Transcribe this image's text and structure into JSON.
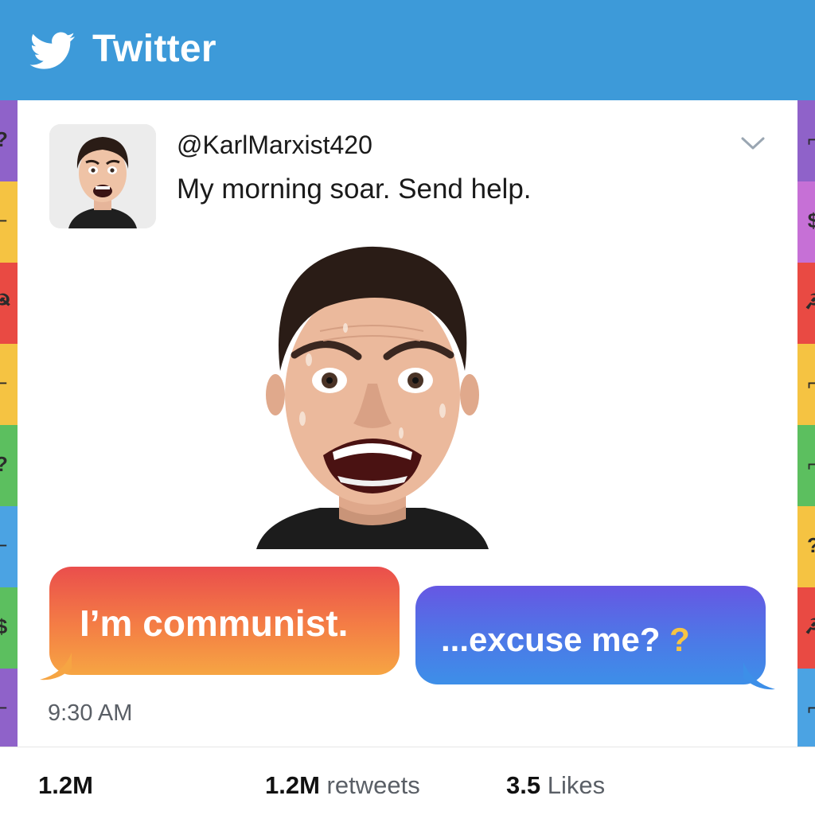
{
  "app": {
    "title": "Twitter"
  },
  "tweet": {
    "handle": "@KarlMarxist420",
    "text": "My morning soar. Send help.",
    "bubbles": {
      "left": "I’m communist.",
      "right": "...excuse me?",
      "right_mark": "?"
    },
    "timestamp": "9:30 AM"
  },
  "stats": {
    "replies": {
      "count": "1.2M",
      "label": ""
    },
    "retweets": {
      "count": "1.2M",
      "label": "retweets"
    },
    "likes": {
      "count": "3.5",
      "label": "Likes"
    }
  },
  "border_tiles": {
    "left": [
      {
        "color": "#8f62c9",
        "glyph": "?"
      },
      {
        "color": "#f5c342",
        "glyph": "⌐"
      },
      {
        "color": "#e94a43",
        "glyph": "☭"
      },
      {
        "color": "#f5c342",
        "glyph": "⌐"
      },
      {
        "color": "#5cbf5f",
        "glyph": "?"
      },
      {
        "color": "#4ba3e3",
        "glyph": "⌐"
      },
      {
        "color": "#5cbf5f",
        "glyph": "$"
      },
      {
        "color": "#8f62c9",
        "glyph": "⌐"
      }
    ],
    "right": [
      {
        "color": "#8f62c9",
        "glyph": "⌐"
      },
      {
        "color": "#c670d6",
        "glyph": "$"
      },
      {
        "color": "#e94a43",
        "glyph": "☭"
      },
      {
        "color": "#f5c342",
        "glyph": "⌐"
      },
      {
        "color": "#5cbf5f",
        "glyph": "⌐"
      },
      {
        "color": "#f5c342",
        "glyph": "?"
      },
      {
        "color": "#e94a43",
        "glyph": "☭"
      },
      {
        "color": "#4ba3e3",
        "glyph": "⌐"
      }
    ]
  },
  "colors": {
    "brand": "#3d9ad9",
    "bubble_left": "#ea4e4c",
    "bubble_right": "#4c79e7"
  }
}
